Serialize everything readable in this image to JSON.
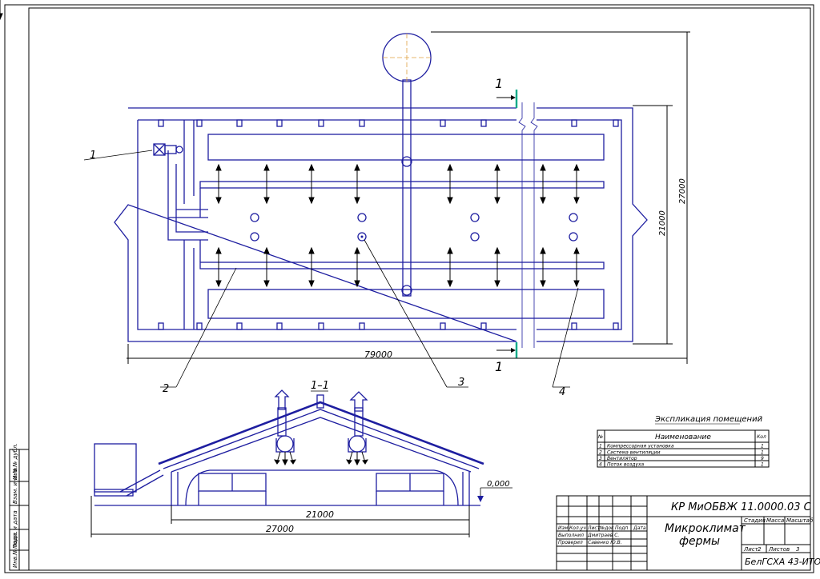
{
  "drawing": {
    "plan_dims": {
      "overall_length": "79000",
      "height_inner": "21000",
      "height_outer": "27000"
    },
    "section": {
      "label": "1–1",
      "cut_mark": "1",
      "span_inner": "21000",
      "span_outer": "27000",
      "level_mark": "0,000"
    },
    "callouts": [
      "1",
      "2",
      "3",
      "4"
    ]
  },
  "explication": {
    "title": "Экспликация помещений",
    "headers": {
      "num": "№",
      "name": "Наименование",
      "qty": "Кол"
    },
    "rows": [
      {
        "num": "1",
        "name": "Компрессорная установка",
        "qty": "1"
      },
      {
        "num": "2",
        "name": "Система вентиляции",
        "qty": "1"
      },
      {
        "num": "3",
        "name": "Вентилятор",
        "qty": "9"
      },
      {
        "num": "4",
        "name": "Поток воздуха",
        "qty": "1"
      }
    ]
  },
  "title_block": {
    "code": "КР МиОБВЖ 11.0000.03 С",
    "title_line1": "Микроклимат",
    "title_line2": "фермы",
    "col_izm": "Изм",
    "col_kol": "Кол.уч",
    "col_list": "Лист",
    "col_ndok": "№док",
    "col_podp": "Подп",
    "col_data": "Дата",
    "role1": "Выполнил",
    "person1": "Дмитраев С.",
    "role2": "Проверил",
    "person2": "Савенко Ю.В.",
    "stage": "Стадия",
    "mass": "Масса",
    "scale": "Масштаб",
    "sheet": "Лист",
    "sheet_no": "2",
    "sheets": "Листов",
    "sheets_no": "3",
    "org": "БелГСХА 43-ИТО"
  },
  "side_stamps": [
    "Инв.№ подл.",
    "Подп. и дата",
    "Взам. инв.№",
    "Инв.№ дубл.",
    "Подп. и дата"
  ]
}
